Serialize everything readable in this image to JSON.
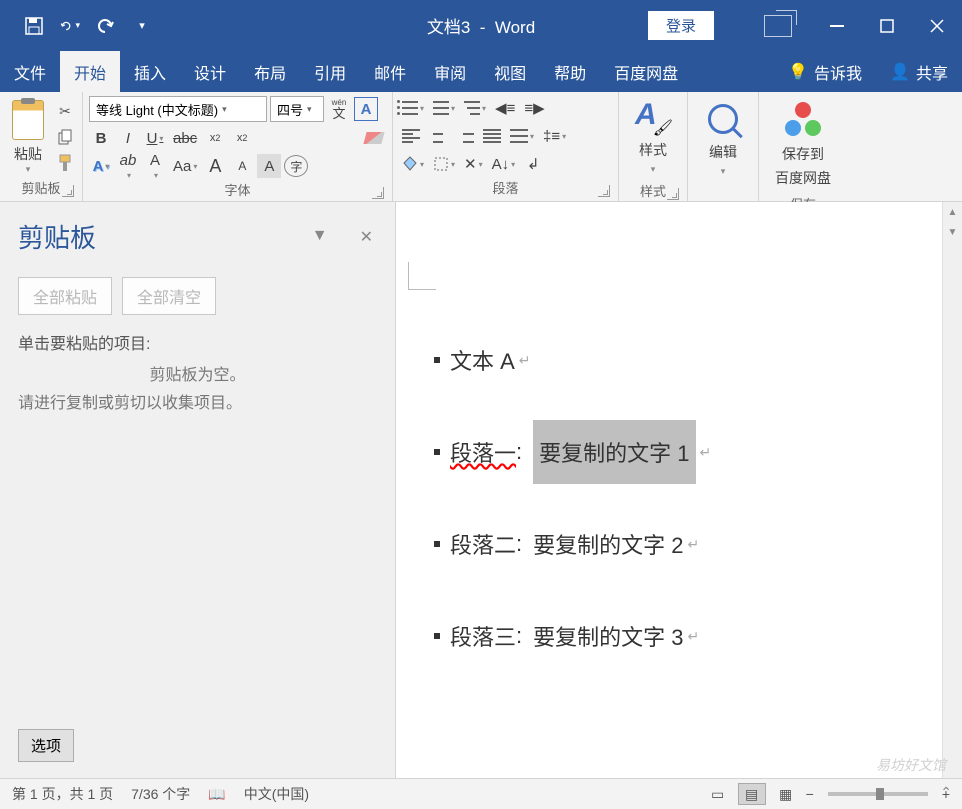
{
  "title": {
    "doc": "文档3",
    "app": "Word"
  },
  "titlebar": {
    "login": "登录"
  },
  "menu": {
    "items": [
      "文件",
      "开始",
      "插入",
      "设计",
      "布局",
      "引用",
      "邮件",
      "审阅",
      "视图",
      "帮助",
      "百度网盘"
    ],
    "active_index": 1,
    "tell_me": "告诉我",
    "share": "共享"
  },
  "ribbon": {
    "clipboard": {
      "label": "剪贴板",
      "paste": "粘贴"
    },
    "font": {
      "label": "字体",
      "name": "等线 Light (中文标题)",
      "size": "四号",
      "wen": "wén",
      "wen_char": "文",
      "bold": "B",
      "italic": "I",
      "underline": "U",
      "strike": "abc",
      "sub": "x",
      "sup": "x",
      "text_effect": "A",
      "highlight": "ab",
      "font_color": "A",
      "char_scale": "Aa",
      "grow": "A",
      "shrink": "A",
      "clear_fmt": "A",
      "enclose": "字"
    },
    "paragraph": {
      "label": "段落"
    },
    "styles": {
      "label": "样式",
      "btn": "样式"
    },
    "editing": {
      "btn": "编辑"
    },
    "save": {
      "label": "保存",
      "btn1": "保存到",
      "btn2": "百度网盘"
    }
  },
  "pane": {
    "title": "剪贴板",
    "paste_all": "全部粘贴",
    "clear_all": "全部清空",
    "hint1": "单击要粘贴的项目:",
    "empty": "剪贴板为空。",
    "hint2": "请进行复制或剪切以收集项目。",
    "options": "选项"
  },
  "document": {
    "lines": [
      {
        "text": "文本 A"
      },
      {
        "label": "段落一",
        "squiggle": true,
        "colon": ":",
        "content": "要复制的文字 1",
        "selected": true
      },
      {
        "label": "段落二",
        "colon": ":",
        "content": "要复制的文字 2"
      },
      {
        "label": "段落三",
        "colon": ":",
        "content": "要复制的文字 3"
      }
    ]
  },
  "status": {
    "page": "第 1 页，共 1 页",
    "words": "7/36 个字",
    "lang": "中文(中国)",
    "zoom_minus": "−",
    "zoom_plus": "+"
  },
  "watermark": "易坊好文馆"
}
